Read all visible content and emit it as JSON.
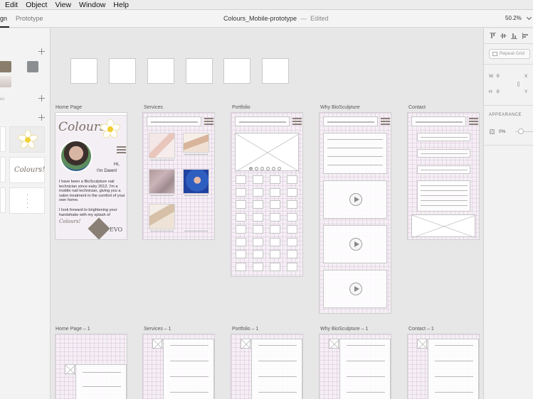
{
  "menubar": {
    "items": [
      "Edit",
      "Object",
      "View",
      "Window",
      "Help"
    ]
  },
  "toolbar": {
    "tab_design": "gn",
    "tab_prototype": "Prototype",
    "doc_title": "Colours_Mobile-prototype",
    "separator": "—",
    "status": "Edited",
    "zoom": "50.2%"
  },
  "leftpanel": {
    "label_styles": "es"
  },
  "artboards": {
    "home": "Home Page",
    "services": "Services",
    "portfolio": "Portfolio",
    "why": "Why BioSculpture",
    "contact": "Contact",
    "home1": "Home Page – 1",
    "services1": "Services – 1",
    "portfolio1": "Portfolio – 1",
    "why1": "Why BioSculpture – 1",
    "contact1": "Contact – 1"
  },
  "home_page": {
    "logo": "Colours!",
    "greeting_line1": "Hi,",
    "greeting_line2": "I'm Dawn!",
    "intro": "I have been a BioSculpture nail technician since ealry 2012. I'm a mobile nail technician, giving you a salon treatment in the comfort of your own home.",
    "closing": "I look forward to brightening your handshake with my splash of",
    "signoff": "Colours!",
    "badge": "EVO"
  },
  "inspector": {
    "repeat_grid": "Repeat Grid",
    "w_label": "W",
    "w_value": "0",
    "x_label": "X",
    "h_label": "H",
    "h_value": "0",
    "y_label": "Y",
    "appearance_heading": "APPEARANCE",
    "opacity": "0%"
  },
  "colors": {
    "swatch_brown": "#8a7d6c",
    "swatch_grey": "#8a8e91",
    "swatch_light": "#d8d2cf",
    "artboard_tint": "#f4eff4"
  }
}
